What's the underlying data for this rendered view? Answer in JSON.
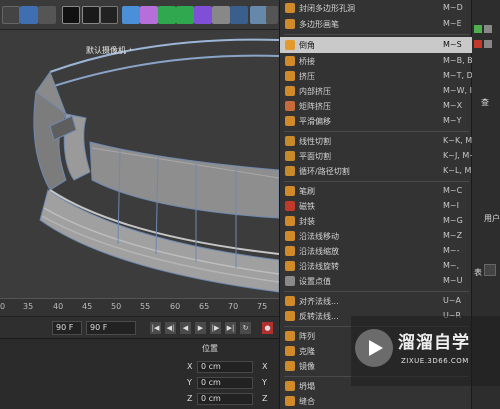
{
  "viewport": {
    "camera_label": "默认摄像机 ⁺",
    "ruler_ticks": [
      "0",
      "35",
      "40",
      "45",
      "50",
      "55",
      "60",
      "65",
      "70",
      "75"
    ]
  },
  "timeline": {
    "frame_left": "90 F",
    "frame_right": "90 F"
  },
  "attributes": {
    "header": "位置",
    "rows": [
      {
        "axis": "X",
        "value": "0 cm",
        "axis2": "X"
      },
      {
        "axis": "Y",
        "value": "0 cm",
        "axis2": "Y"
      },
      {
        "axis": "Z",
        "value": "0 cm",
        "axis2": "Z"
      }
    ]
  },
  "menu": {
    "items": [
      {
        "label": "封闭多边形孔洞",
        "shortcut": "M~D",
        "icon_color": "#d08a2a",
        "icon": "fill-hole-icon"
      },
      {
        "label": "多边形画笔",
        "shortcut": "M~E",
        "icon_color": "#d08a2a",
        "icon": "polygon-pen-icon"
      },
      {
        "label": "倒角",
        "shortcut": "M~S",
        "icon_color": "#e29a2d",
        "icon": "bevel-icon",
        "selected": true
      },
      {
        "label": "桥接",
        "shortcut": "M~B, B",
        "icon_color": "#d08a2a",
        "icon": "bridge-icon"
      },
      {
        "label": "挤压",
        "shortcut": "M~T, D",
        "icon_color": "#d08a2a",
        "icon": "extrude-icon"
      },
      {
        "label": "内部挤压",
        "shortcut": "M~W, I",
        "icon_color": "#d08a2a",
        "icon": "extrude-inner-icon"
      },
      {
        "label": "矩阵挤压",
        "shortcut": "M~X",
        "icon_color": "#c76a3a",
        "icon": "matrix-extrude-icon"
      },
      {
        "label": "平滑偏移",
        "shortcut": "M~Y",
        "icon_color": "#d08a2a",
        "icon": "smooth-shift-icon"
      },
      {
        "label": "线性切割",
        "shortcut": "K~K, M~K",
        "icon_color": "#c78a2a",
        "icon": "line-cut-icon"
      },
      {
        "label": "平面切割",
        "shortcut": "K~J, M~J",
        "icon_color": "#c78a2a",
        "icon": "plane-cut-icon"
      },
      {
        "label": "循环/路径切割",
        "shortcut": "K~L, M~L",
        "icon_color": "#c78a2a",
        "icon": "loop-cut-icon"
      },
      {
        "label": "笔刷",
        "shortcut": "M~C",
        "icon_color": "#d08a2a",
        "icon": "brush-icon"
      },
      {
        "label": "磁铁",
        "shortcut": "M~I",
        "icon_color": "#c0392b",
        "icon": "magnet-icon"
      },
      {
        "label": "封装",
        "shortcut": "M~G",
        "icon_color": "#d08a2a",
        "icon": "iron-icon"
      },
      {
        "label": "沿法线移动",
        "shortcut": "M~Z",
        "icon_color": "#d08a2a",
        "icon": "normal-move-icon"
      },
      {
        "label": "沿法线缩放",
        "shortcut": "M~-",
        "icon_color": "#d08a2a",
        "icon": "normal-scale-icon"
      },
      {
        "label": "沿法线旋转",
        "shortcut": "M~,",
        "icon_color": "#d08a2a",
        "icon": "normal-rotate-icon"
      },
      {
        "label": "设置点值",
        "shortcut": "M~U",
        "icon_color": "#8a8a8a",
        "icon": "set-point-value-icon"
      },
      {
        "label": "对齐法线...",
        "shortcut": "U~A",
        "icon_color": "#d08a2a",
        "icon": "align-normals-icon"
      },
      {
        "label": "反转法线...",
        "shortcut": "U~R",
        "icon_color": "#d08a2a",
        "icon": "reverse-normals-icon"
      },
      {
        "label": "阵列",
        "shortcut": "",
        "icon_color": "#d08a2a",
        "icon": "array-icon"
      },
      {
        "label": "克隆",
        "shortcut": "",
        "icon_color": "#d08a2a",
        "icon": "clone-icon"
      },
      {
        "label": "镜像",
        "shortcut": "",
        "icon_color": "#d08a2a",
        "icon": "mirror-icon"
      },
      {
        "label": "坍塌",
        "shortcut": "",
        "icon_color": "#d08a2a",
        "icon": "collapse-icon"
      },
      {
        "label": "缝合",
        "shortcut": "",
        "icon_color": "#d08a2a",
        "icon": "stitch-icon"
      }
    ]
  },
  "right_panel": {
    "tab1": "查",
    "tab2": "用户",
    "tab3": "表"
  },
  "watermark": {
    "title": "溜溜自学",
    "url": "ZIXUE.3D66.COM"
  }
}
